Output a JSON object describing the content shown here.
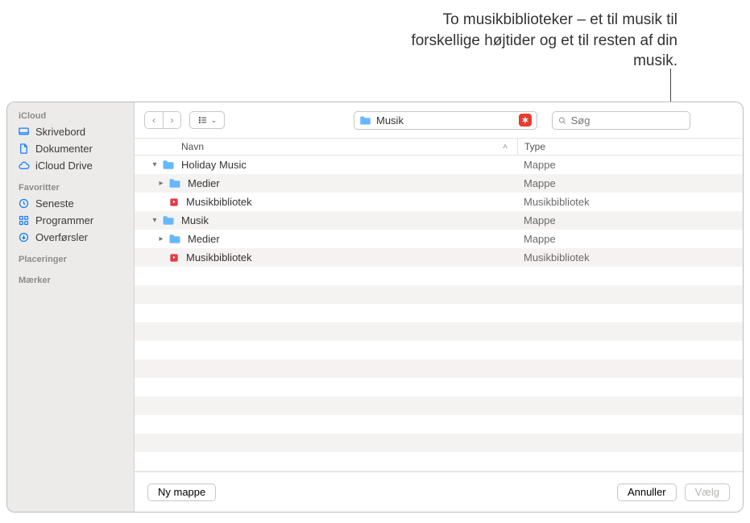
{
  "annotation": "To musikbiblioteker – et til musik til forskellige højtider og et til resten af din musik.",
  "sidebar": {
    "sections": [
      {
        "header": "iCloud",
        "items": [
          {
            "label": "Skrivebord",
            "name": "sidebar-item-desktop",
            "icon": "desktop"
          },
          {
            "label": "Dokumenter",
            "name": "sidebar-item-documents",
            "icon": "document"
          },
          {
            "label": "iCloud Drive",
            "name": "sidebar-item-icloud",
            "icon": "cloud"
          }
        ]
      },
      {
        "header": "Favoritter",
        "items": [
          {
            "label": "Seneste",
            "name": "sidebar-item-recents",
            "icon": "clock"
          },
          {
            "label": "Programmer",
            "name": "sidebar-item-apps",
            "icon": "apps"
          },
          {
            "label": "Overførsler",
            "name": "sidebar-item-downloads",
            "icon": "download"
          }
        ]
      },
      {
        "header": "Placeringer",
        "items": []
      },
      {
        "header": "Mærker",
        "items": []
      }
    ]
  },
  "toolbar": {
    "path_label": "Musik",
    "search_placeholder": "Søg"
  },
  "columns": {
    "name": "Navn",
    "type": "Type"
  },
  "rows": [
    {
      "indent": 0,
      "disclosure": "down",
      "icon": "folder",
      "name": "Holiday Music",
      "type": "Mappe"
    },
    {
      "indent": 1,
      "disclosure": "right",
      "icon": "folder",
      "name": "Medier",
      "type": "Mappe"
    },
    {
      "indent": 1,
      "disclosure": "none",
      "icon": "library",
      "name": "Musikbibliotek",
      "type": "Musikbibliotek"
    },
    {
      "indent": 0,
      "disclosure": "down",
      "icon": "folder",
      "name": "Musik",
      "type": "Mappe"
    },
    {
      "indent": 1,
      "disclosure": "right",
      "icon": "folder",
      "name": "Medier",
      "type": "Mappe"
    },
    {
      "indent": 1,
      "disclosure": "none",
      "icon": "library",
      "name": "Musikbibliotek",
      "type": "Musikbibliotek"
    }
  ],
  "footer": {
    "new_folder": "Ny mappe",
    "cancel": "Annuller",
    "choose": "Vælg"
  }
}
